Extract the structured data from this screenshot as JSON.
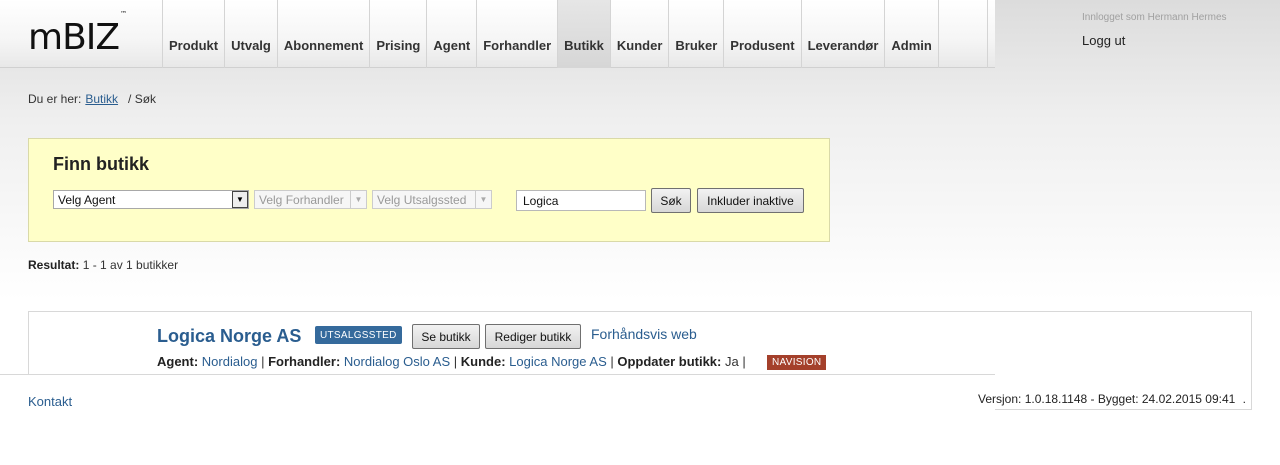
{
  "header": {
    "logo": "mBIZ",
    "logo_tm": "™",
    "nav": [
      "Produkt",
      "Utvalg",
      "Abonnement",
      "Prising",
      "Agent",
      "Forhandler",
      "Butikk",
      "Kunder",
      "Bruker",
      "Produsent",
      "Leverandør",
      "Admin"
    ],
    "active_nav": "Butikk",
    "login_info": "Innlogget som Hermann Hermes",
    "logout": "Logg ut"
  },
  "breadcrumb": {
    "prefix": "Du er her:",
    "link": "Butikk",
    "current": "/ Søk"
  },
  "search": {
    "title": "Finn butikk",
    "agent_select": "Velg Agent",
    "dealer_select": "Velg Forhandler",
    "outlet_select": "Velg Utsalgssted",
    "query_value": "Logica",
    "search_button": "Søk",
    "include_inactive_button": "Inkluder inaktive"
  },
  "result": {
    "label": "Resultat:",
    "text": "1 - 1 av 1 butikker"
  },
  "store": {
    "name": "Logica Norge AS",
    "type_badge": "UTSALGSSTED",
    "view_button": "Se butikk",
    "edit_button": "Rediger butikk",
    "preview_link": "Forhåndsvis web",
    "agent_label": "Agent:",
    "agent_value": "Nordialog",
    "dealer_label": "Forhandler:",
    "dealer_value": "Nordialog Oslo AS",
    "customer_label": "Kunde:",
    "customer_value": "Logica Norge AS",
    "update_label": "Oppdater butikk:",
    "update_value": "Ja",
    "system_badge": "NAVISION"
  },
  "footer": {
    "contact": "Kontakt",
    "version": "Versjon: 1.0.18.1148 - Bygget: 24.02.2015 09:41",
    "version_suffix": "."
  }
}
